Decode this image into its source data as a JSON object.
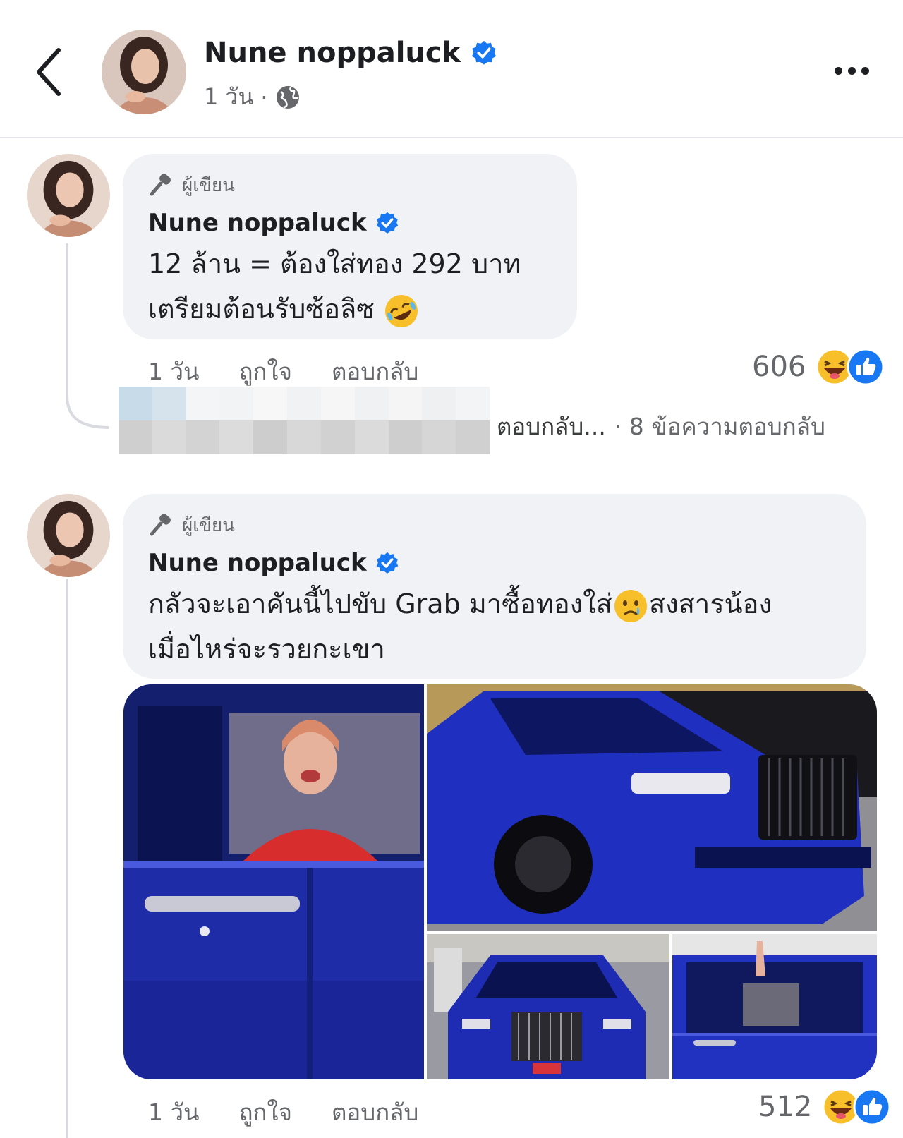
{
  "header": {
    "name": "Nune noppaluck",
    "time": "1 วัน",
    "separator": "·"
  },
  "comments": [
    {
      "author_badge": "ผู้เขียน",
      "name": "Nune noppaluck",
      "line1": "12 ล้าน = ต้องใส่ทอง 292 บาท",
      "line2": "เตรียมต้อนรับซ้อลิซ",
      "time": "1 วัน",
      "like_label": "ถูกใจ",
      "reply_label": "ตอบกลับ",
      "reaction_count": "606",
      "emoji": "rolling-on-floor-laughing"
    },
    {
      "author_badge": "ผู้เขียน",
      "name": "Nune noppaluck",
      "line1_a": "กลัวจะเอาคันนี้ไปขับ Grab มาซื้อทองใส่",
      "line1_b": "สงสารน้อง",
      "line2": "เมื่อไหร่จะรวยกะเขา",
      "time": "1 วัน",
      "like_label": "ถูกใจ",
      "reply_label": "ตอบกลับ",
      "reaction_count": "512",
      "emoji": "crying-face"
    }
  ],
  "reply_preview": {
    "label": "ตอบกลับ...",
    "count_text": "· 8 ข้อความตอบกลับ"
  },
  "colors": {
    "verified_blue": "#1877f2",
    "bubble_bg": "#f0f2f5",
    "secondary_text": "#65676b",
    "car_blue": "#1f2fb0"
  }
}
